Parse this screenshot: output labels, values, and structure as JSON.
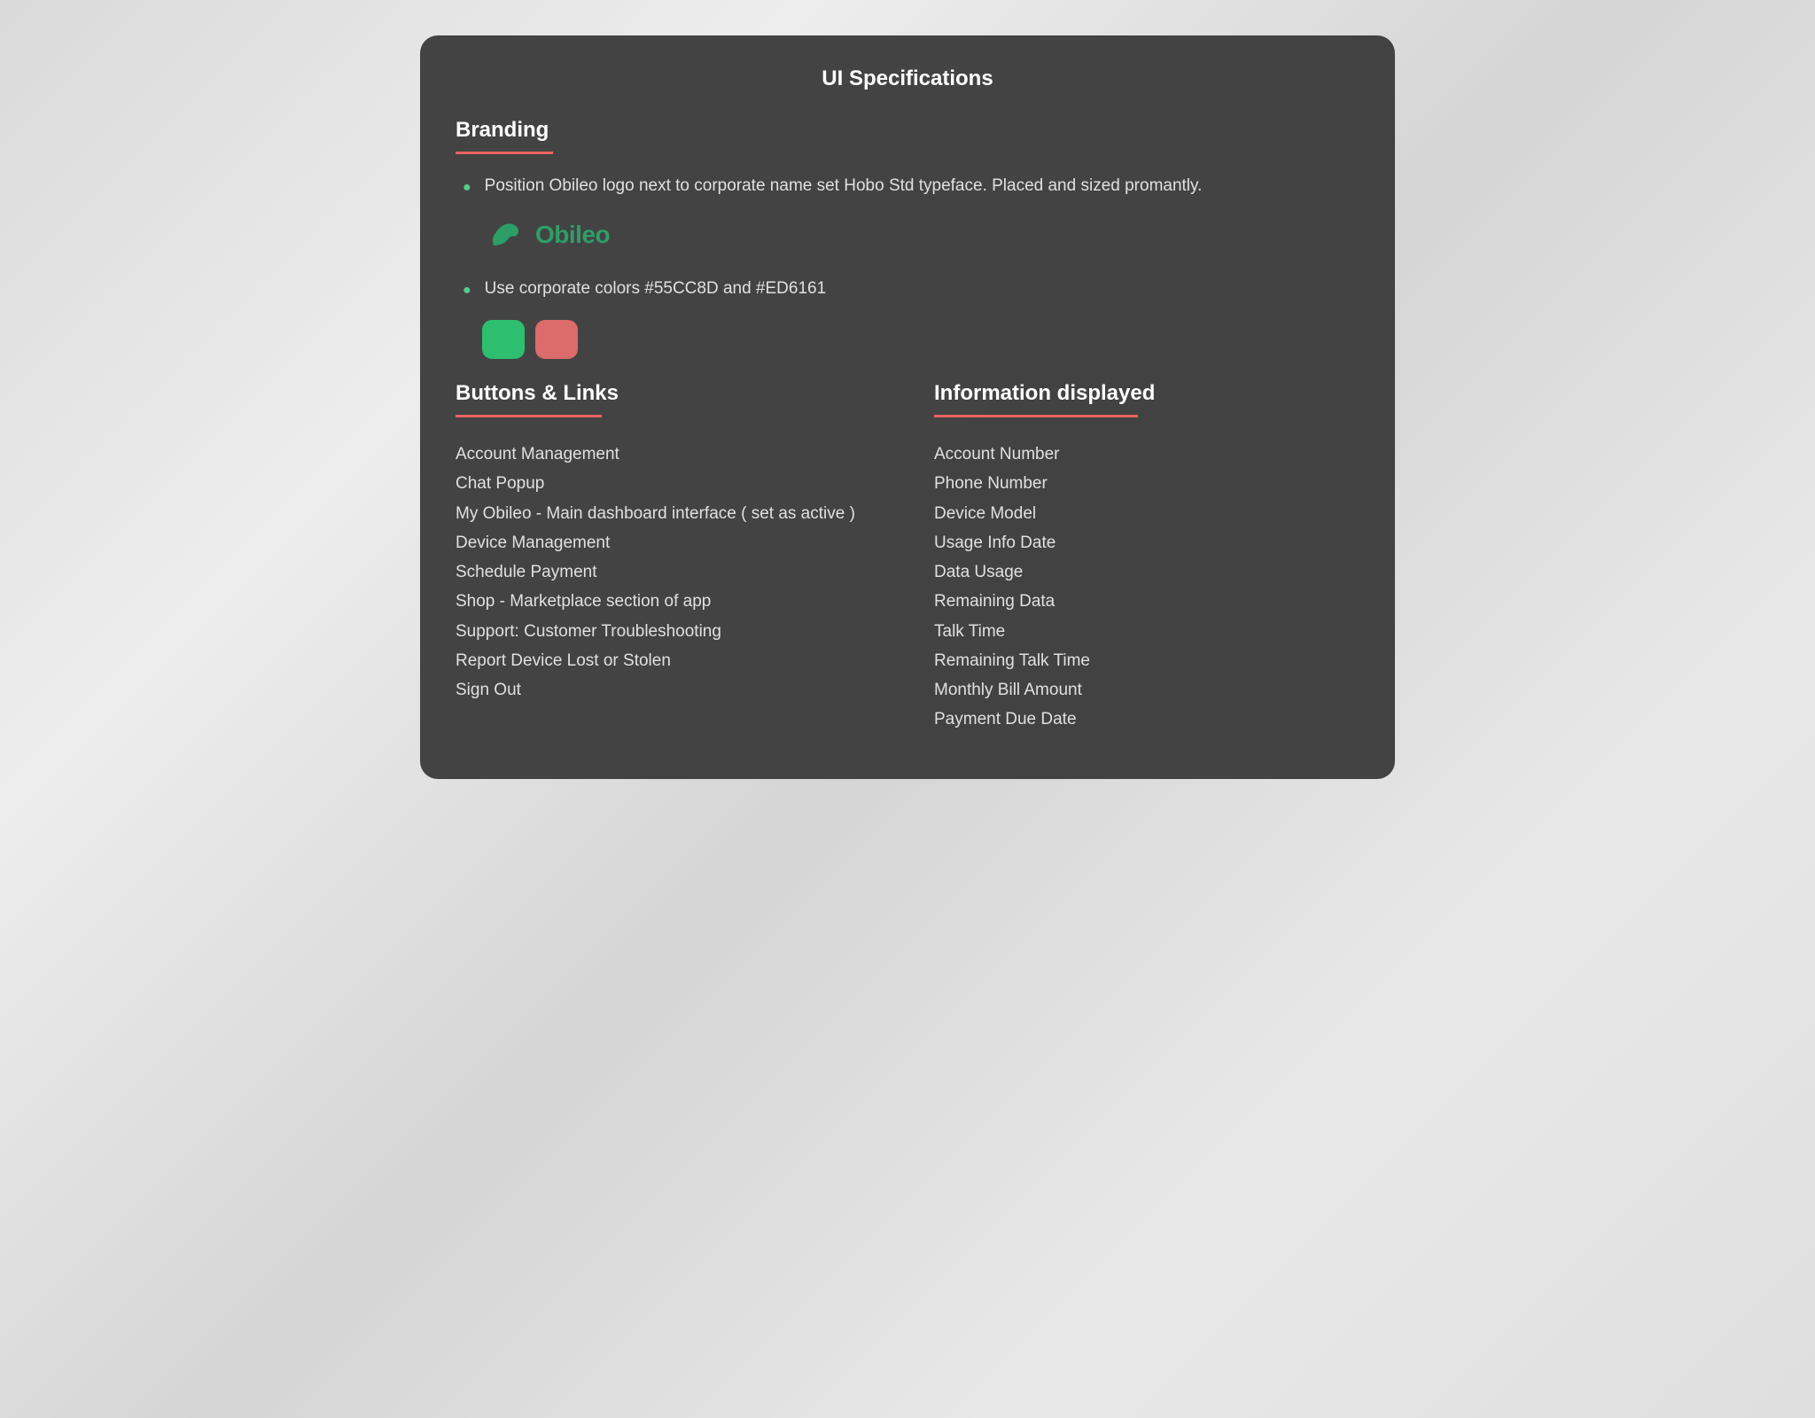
{
  "title": "UI Specifications",
  "branding": {
    "heading": "Branding",
    "bullets": [
      "Position Obileo logo next to corporate name set Hobo Std typeface. Placed and sized promantly.",
      "Use corporate colors #55CC8D and #ED6161"
    ],
    "logoText": "Obileo",
    "colors": {
      "primary": "#55CC8D",
      "secondary": "#ED6161"
    }
  },
  "buttonsLinks": {
    "heading": "Buttons & Links",
    "items": [
      "Account Management",
      "Chat Popup",
      "My Obileo - Main dashboard interface ( set as active )",
      "Device Management",
      "Schedule Payment",
      "Shop - Marketplace section of app",
      "Support: Customer Troubleshooting",
      "Report Device Lost or Stolen",
      "Sign Out"
    ]
  },
  "informationDisplayed": {
    "heading": "Information displayed",
    "items": [
      "Account Number",
      "Phone Number",
      "Device Model",
      "Usage Info Date",
      "Data Usage",
      "Remaining Data",
      "Talk Time",
      "Remaining Talk Time",
      "Monthly Bill Amount",
      "Payment Due Date"
    ]
  }
}
